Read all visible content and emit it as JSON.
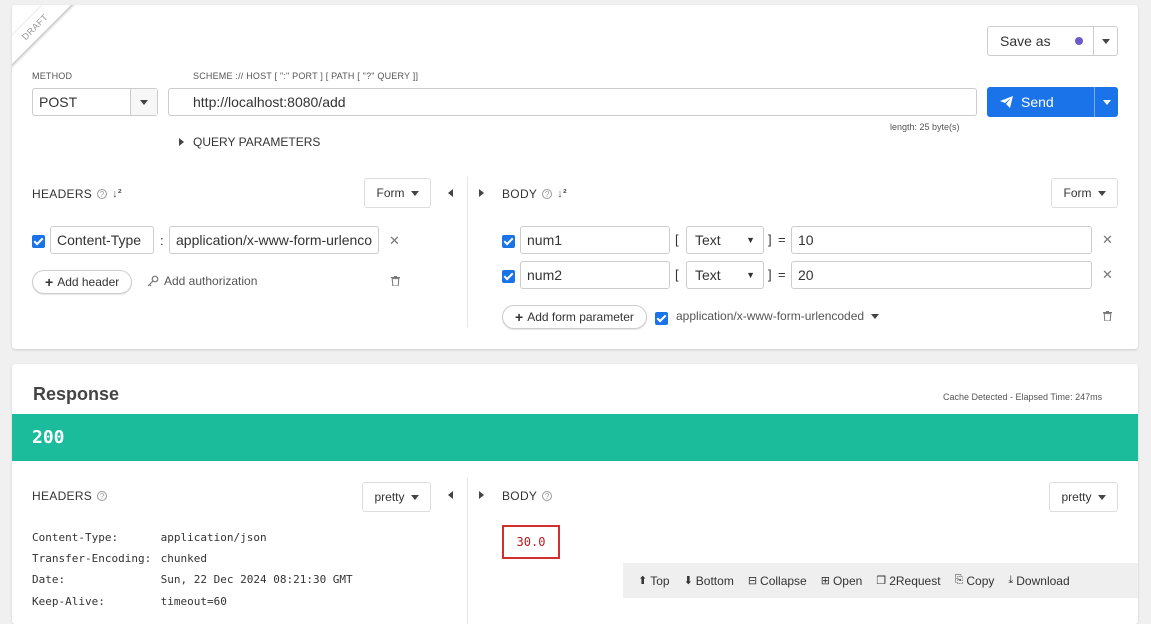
{
  "request": {
    "draft_label": "DRAFT",
    "save_as_label": "Save as",
    "method_label": "METHOD",
    "method_value": "POST",
    "url_hint": "SCHEME :// HOST [ \":\" PORT ] [ PATH [ \"?\" QUERY ]]",
    "url_value": "http://localhost:8080/add",
    "length_info": "length: 25 byte(s)",
    "send_label": "Send",
    "query_params_label": "QUERY PARAMETERS",
    "headers": {
      "title": "HEADERS",
      "mode": "Form",
      "rows": [
        {
          "name": "Content-Type",
          "separator": ":",
          "value": "application/x-www-form-urlenco"
        }
      ],
      "add_header_label": "Add header",
      "add_auth_label": "Add authorization"
    },
    "body": {
      "title": "BODY",
      "mode": "Form",
      "rows": [
        {
          "name": "num1",
          "type": "Text",
          "value": "10"
        },
        {
          "name": "num2",
          "type": "Text",
          "value": "20"
        }
      ],
      "bracket_open": "[",
      "bracket_close": "]",
      "equals": "=",
      "add_param_label": "Add form parameter",
      "content_type": "application/x-www-form-urlencoded"
    }
  },
  "response": {
    "title": "Response",
    "cache_info": "Cache Detected - Elapsed Time: 247ms",
    "status_code": "200",
    "status_color": "#1abc9c",
    "headers": {
      "title": "HEADERS",
      "mode": "pretty",
      "rows": [
        {
          "key": "Content-Type:",
          "value": "application/json"
        },
        {
          "key": "Transfer-Encoding:",
          "value": "chunked"
        },
        {
          "key": "Date:",
          "value": "Sun, 22 Dec 2024 08:21:30 GMT"
        },
        {
          "key": "Keep-Alive:",
          "value": "timeout=60"
        }
      ]
    },
    "body": {
      "title": "BODY",
      "mode": "pretty",
      "value": "30.0"
    },
    "toolbar": {
      "top": "Top",
      "bottom": "Bottom",
      "collapse": "Collapse",
      "open": "Open",
      "request": "2Request",
      "copy": "Copy",
      "download": "Download"
    }
  },
  "colors": {
    "accent": "#1a73e8",
    "send_button": "#1a73e8",
    "status_bar": "#1abc9c",
    "highlight_border": "#d32f2f",
    "body_value": "#b71c1c"
  }
}
